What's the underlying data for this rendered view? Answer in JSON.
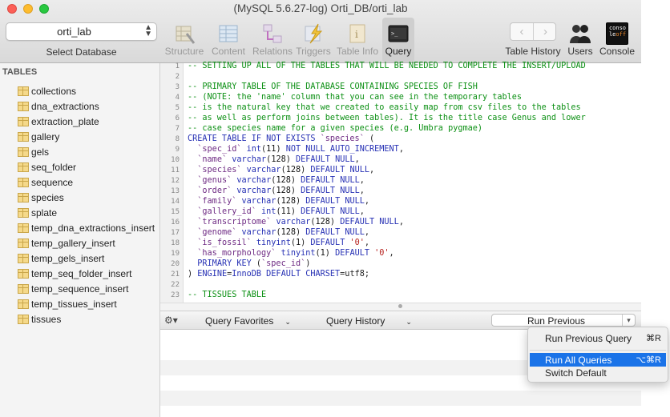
{
  "window": {
    "title": "(MySQL 5.6.27-log) Orti_DB/orti_lab"
  },
  "database_selector": {
    "value": "orti_lab",
    "label": "Select Database"
  },
  "toolbar": {
    "structure": "Structure",
    "content": "Content",
    "relations": "Relations",
    "triggers": "Triggers",
    "table_info": "Table Info",
    "query": "Query",
    "table_history": "Table History",
    "users": "Users",
    "console": "Console",
    "console_icon_line1": "conso",
    "console_icon_line2": "le",
    "console_icon_line3": "off"
  },
  "sidebar": {
    "heading": "TABLES",
    "tables": [
      "collections",
      "dna_extractions",
      "extraction_plate",
      "gallery",
      "gels",
      "seq_folder",
      "sequence",
      "species",
      "splate",
      "temp_dna_extractions_insert",
      "temp_gallery_insert",
      "temp_gels_insert",
      "temp_seq_folder_insert",
      "temp_sequence_insert",
      "temp_tissues_insert",
      "tissues"
    ]
  },
  "editor": {
    "line_numbers": [
      "1",
      "2",
      "3",
      "4",
      "5",
      "6",
      "7",
      "8",
      "9",
      "10",
      "11",
      "12",
      "13",
      "14",
      "15",
      "16",
      "17",
      "18",
      "19",
      "20",
      "21",
      "22",
      "23"
    ]
  },
  "query_bar": {
    "favorites": "Query Favorites",
    "history": "Query History",
    "run_button": "Run Previous"
  },
  "run_menu": {
    "items": [
      {
        "label": "Run Previous Query",
        "shortcut": "⌘R"
      },
      {
        "label": "Run All Queries",
        "shortcut": "⌥⌘R"
      },
      {
        "label": "Switch Default",
        "shortcut": ""
      }
    ]
  },
  "colors": {
    "comment": "#0c9014",
    "keyword": "#2630b4",
    "field": "#6e2a83",
    "string": "#b7221e",
    "highlight": "#1a73e8"
  }
}
